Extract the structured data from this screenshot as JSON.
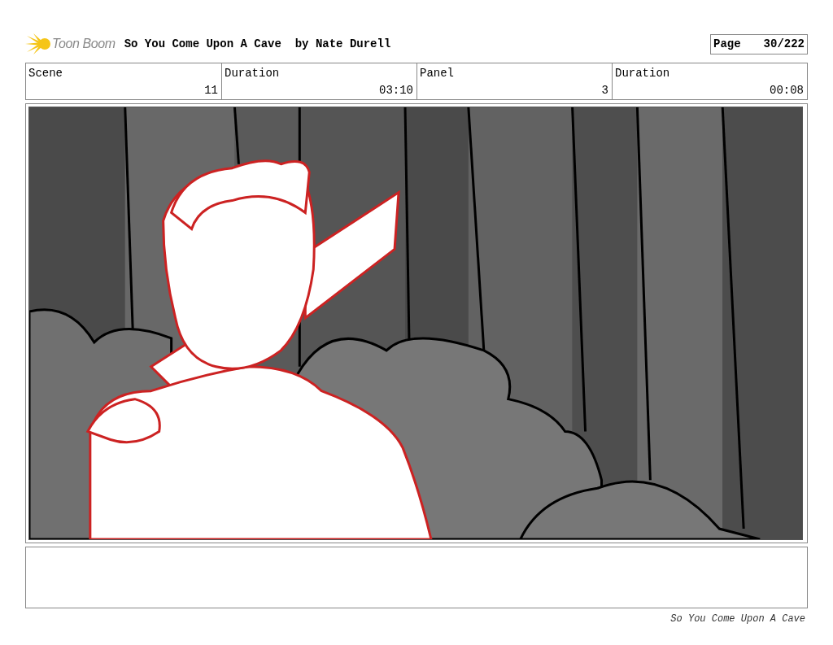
{
  "header": {
    "logo": "Toon Boom",
    "title": "So You Come Upon A Cave  by Nate Durell",
    "page_label": "Page",
    "page_number": "30/222"
  },
  "info_table": {
    "columns": [
      "Scene",
      "Duration",
      "Panel",
      "Duration"
    ],
    "rows": [
      [
        "11",
        "03:10",
        "3",
        "00:08"
      ]
    ]
  },
  "footer": "So You Come Upon A Cave"
}
